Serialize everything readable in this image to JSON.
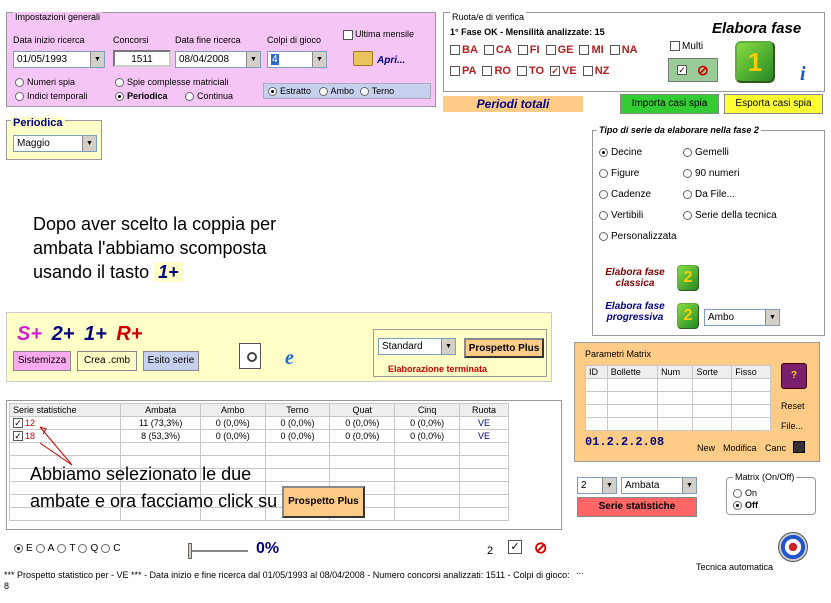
{
  "general": {
    "title": "Impostazioni generali",
    "date_start_label": "Data inizio ricerca",
    "date_start": "01/05/1993",
    "concorsi_label": "Concorsi",
    "concorsi": "1511",
    "date_end_label": "Data fine ricerca",
    "date_end": "08/04/2008",
    "colpi_label": "Colpi di gioco",
    "colpi": "4",
    "ultima_mensile": "Ultima mensile",
    "apri": "Apri...",
    "numeri_spia": "Numeri spia",
    "indici_temporali": "Indici temporali",
    "spie_complesse": "Spie complesse matriciali",
    "periodica": "Periodica",
    "continua": "Continua",
    "estratto": "Estratto",
    "ambo": "Ambo",
    "terno": "Terno"
  },
  "ruote": {
    "title": "Ruota/e di verifica",
    "status": "1° Fase OK - Mensilità analizzate: 15",
    "row1": [
      "BA",
      "CA",
      "FI",
      "GE",
      "MI",
      "NA"
    ],
    "row2": [
      "PA",
      "RO",
      "TO",
      "VE",
      "NZ"
    ],
    "multi": "Multi",
    "elabora_fase": "Elabora fase",
    "fase_number": "1",
    "check_glyph": "✓",
    "cancel_glyph": "⊘"
  },
  "periodi_totali": "Periodi totali",
  "importa": "Importa casi spia",
  "esporta": "Esporta casi spia",
  "periodica": {
    "title": "Periodica",
    "value": "Maggio"
  },
  "serie_tipo": {
    "title": "Tipo di serie da elaborare nella fase 2",
    "options_left": [
      "Decine",
      "Figure",
      "Cadenze",
      "Vertibili",
      "Personalizzata"
    ],
    "options_right": [
      "Gemelli",
      "90 numeri",
      "Da File...",
      "Serie della tecnica"
    ],
    "elabora_classica": "Elabora fase classica",
    "elabora_progressiva": "Elabora fase progressiva",
    "fase_number": "2",
    "progressiva_value": "Ambo"
  },
  "instruction_1": [
    "Dopo aver scelto la coppia per",
    "ambata l'abbiamo scomposta",
    "usando il tasto"
  ],
  "instruction_1_key": "1+",
  "tools": {
    "s_plus": "S+",
    "two_plus": "2+",
    "one_plus": "1+",
    "r_plus": "R+",
    "sistemizza": "Sistemizza",
    "crea_cmb": "Crea .cmb",
    "esito_serie": "Esito serie",
    "standard": "Standard",
    "prospetto_plus": "Prospetto Plus",
    "elaborazione": "Elaborazione terminata"
  },
  "table": {
    "headers": [
      "Serie statistiche",
      "Ambata",
      "Ambo",
      "Terno",
      "Quat",
      "Cinq",
      "Ruota"
    ],
    "rows": [
      [
        "12",
        "11 (73,3%)",
        "0 (0,0%)",
        "0 (0,0%)",
        "0 (0,0%)",
        "0 (0,0%)",
        "VE"
      ],
      [
        "18",
        "8 (53,3%)",
        "0 (0,0%)",
        "0 (0,0%)",
        "0 (0,0%)",
        "0 (0,0%)",
        "VE"
      ]
    ]
  },
  "instruction_2": [
    "Abbiamo selezionato le due",
    "ambate e ora facciamo click su"
  ],
  "instruction_2_button": "Prospetto Plus",
  "matrix": {
    "title": "Parametri Matrix",
    "headers": [
      "ID",
      "Bollette",
      "Num",
      "Sorte",
      "Fisso"
    ],
    "code": "01.2.2.2.08",
    "reset": "Reset",
    "file": "File...",
    "new": "New",
    "modifica": "Modifica",
    "canc": "Canc"
  },
  "serie_stat": {
    "num": "2",
    "type": "Ambata",
    "button": "Serie statistiche"
  },
  "matrix_onoff": {
    "title": "Matrix (On/Off)",
    "on": "On",
    "off": "Off"
  },
  "bottom_radios": [
    "E",
    "A",
    "T",
    "Q",
    "C"
  ],
  "percent": "0%",
  "bottom_num": "2",
  "tecnica": "Tecnica automatica",
  "ellipsis": "...",
  "status": "*** Prospetto statistico per  - VE ***  - Data inizio e fine ricerca dal 01/05/1993 al 08/04/2008 - Numero concorsi analizzati: 1511 - Colpi di gioco: 8",
  "colors": {
    "pink": "#f5c6f5",
    "yellow": "#ffffc8",
    "orange": "#ffcc88",
    "green": "#33cc33",
    "red": "#ff6666"
  }
}
